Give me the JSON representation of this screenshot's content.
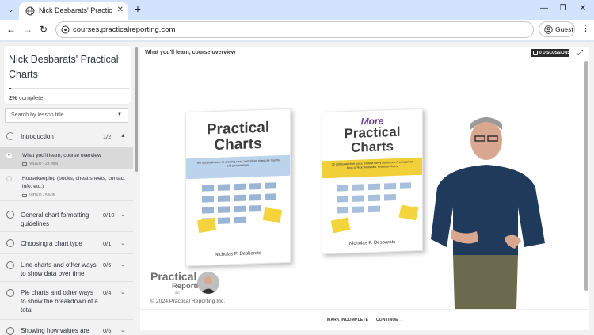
{
  "browser": {
    "tab_title": "Nick Desbarats' Practical Charts",
    "tab_close": "✕",
    "new_tab": "+",
    "url": "courses.practicalreporting.com",
    "profile_label": "Guest",
    "minimize": "—",
    "restore": "❐",
    "close": "✕"
  },
  "sidebar": {
    "course_title": "Nick Desbarats' Practical Charts",
    "progress_value": 2,
    "progress_pct": "2%",
    "progress_suffix": "complete",
    "search_placeholder": "Search by lesson title",
    "sections": [
      {
        "title": "Introduction",
        "count": "1/2",
        "expanded": true
      },
      {
        "title": "General chart formatting guidelines",
        "count": "0/10"
      },
      {
        "title": "Choosing a chart type",
        "count": "0/1"
      },
      {
        "title": "Line charts and other ways to show data over time",
        "count": "0/6"
      },
      {
        "title": "Pie charts and other ways to show the breakdown of a total",
        "count": "0/4"
      },
      {
        "title": "Showing how values are",
        "count": "0/5"
      }
    ],
    "lessons": [
      {
        "title": "What you'll learn, course overview",
        "meta": "VIDEO - 23 MIN",
        "active": true,
        "done": true
      },
      {
        "title": "Housekeeping (books, cheat sheets, contact info, etc.)",
        "meta": "VIDEO - 5 MIN"
      }
    ]
  },
  "main": {
    "lesson_heading": "What you'll learn, course overview",
    "discussions_label": "0 DISCUSSIONS",
    "mark_incomplete": "MARK INCOMPLETE",
    "continue": "CONTINUE →"
  },
  "video": {
    "book1": {
      "title_line1": "Practical",
      "title_line2": "Charts",
      "subtitle": "The essential guide to creating clear, compelling charts for reports and presentations",
      "author": "Nicholas P. Desbarats"
    },
    "book2": {
      "more": "More",
      "title_line1": "Practical",
      "title_line2": "Charts",
      "subtitle": "20 additional chart types for data-savvy audiences. A companion book to Nick Desbarats' Practical Charts",
      "author": "Nicholas P. Desbarats"
    },
    "brand_line1": "Practical",
    "brand_line2": "Reporting",
    "brand_inc": "INC.",
    "copyright": "© 2024 Practical Reporting Inc."
  },
  "colors": {
    "book1_band": "#bcd3ec",
    "book2_band": "#f1cf38",
    "more_purple": "#6a3fa0",
    "tab_bar": "#d3e3fd"
  }
}
